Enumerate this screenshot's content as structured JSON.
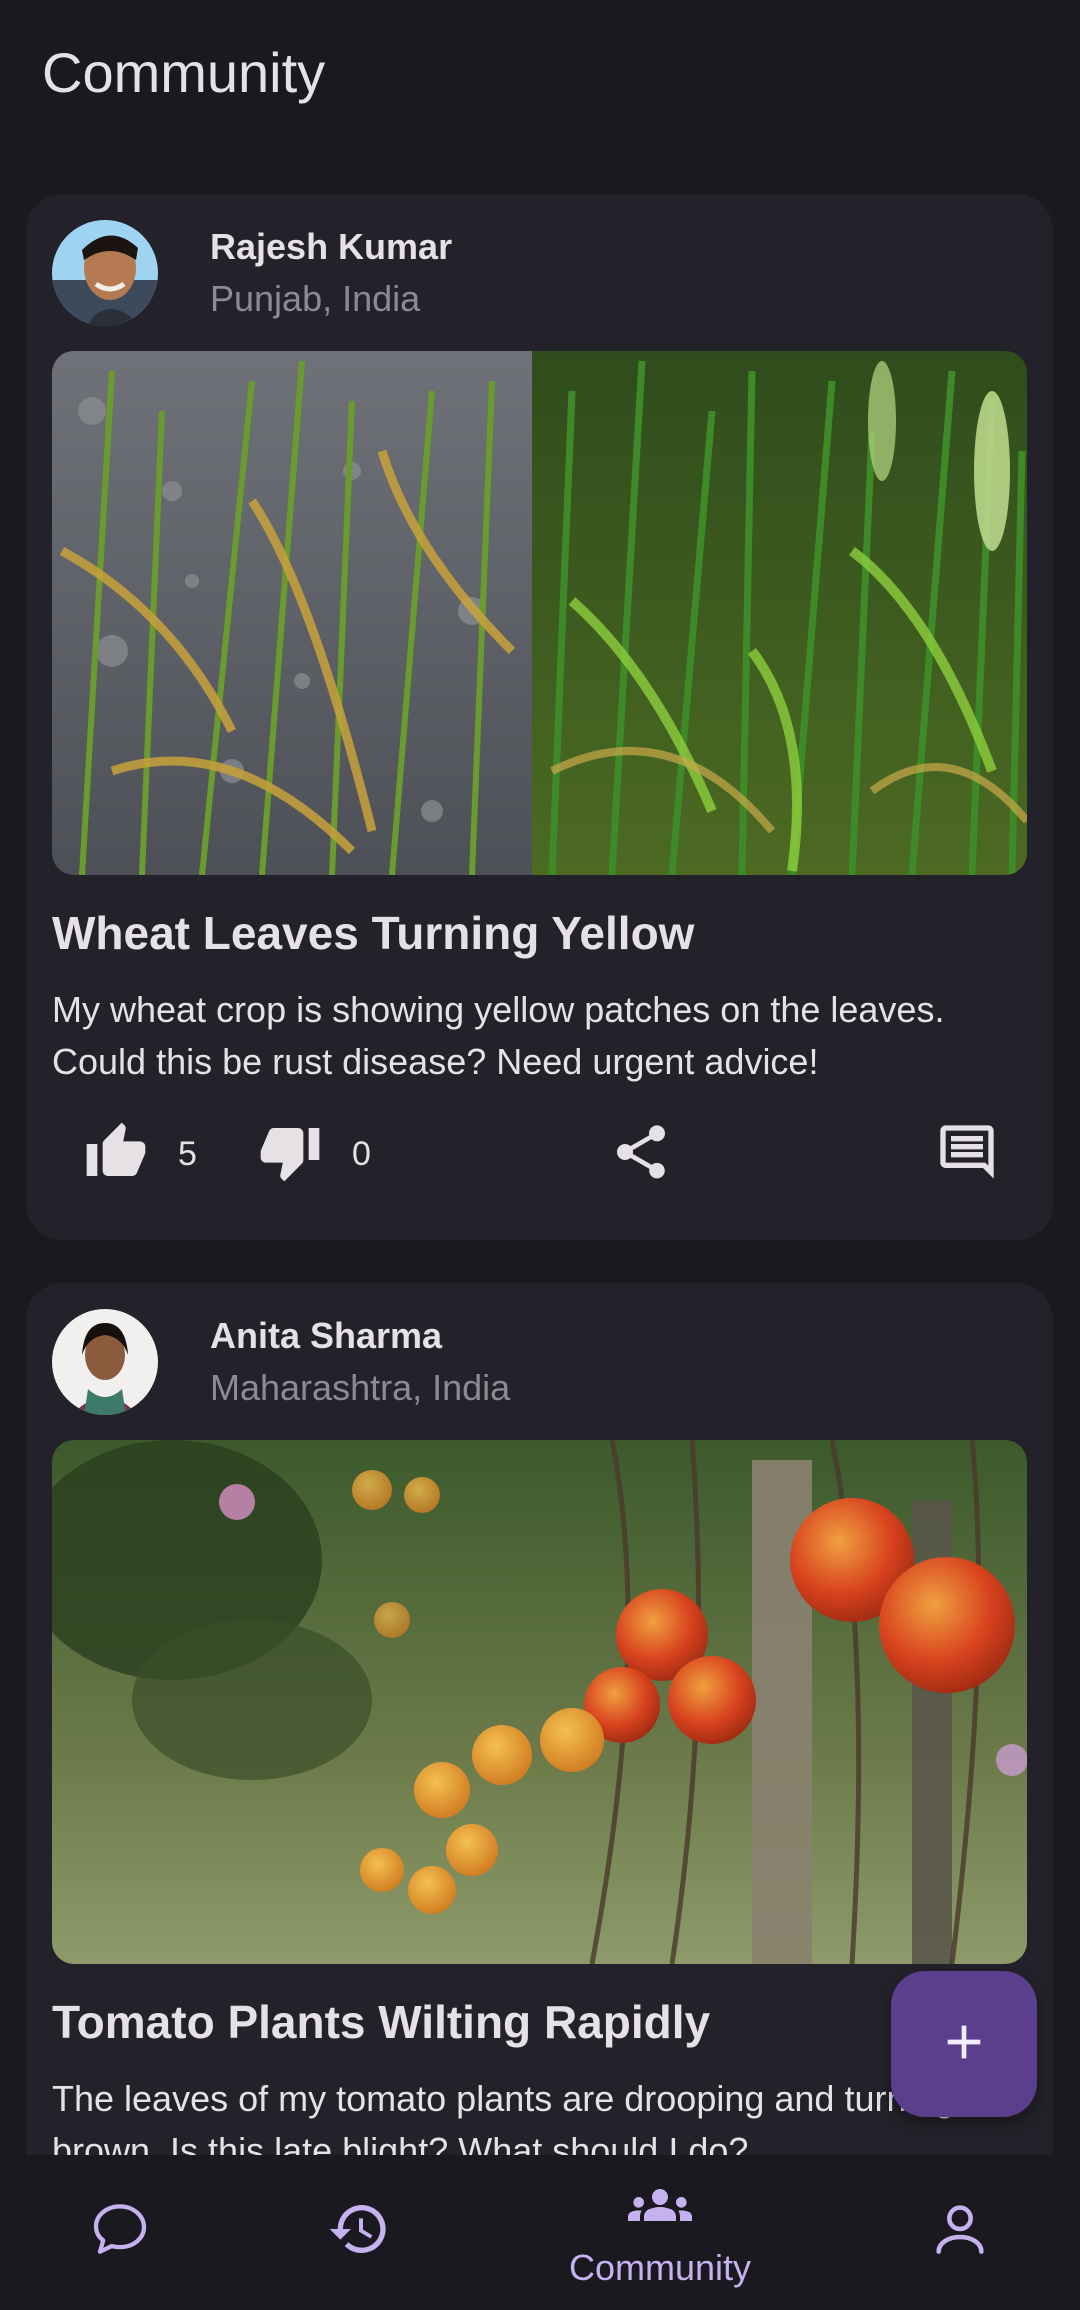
{
  "header": {
    "title": "Community"
  },
  "posts": [
    {
      "author": "Rajesh Kumar",
      "location": "Punjab, India",
      "title": "Wheat Leaves Turning Yellow",
      "body": "My wheat crop is showing yellow patches on the leaves. Could this be rust disease? Need urgent advice!",
      "likes": "5",
      "dislikes": "0"
    },
    {
      "author": "Anita Sharma",
      "location": "Maharashtra, India",
      "title": "Tomato Plants Wilting Rapidly",
      "body": "The leaves of my tomato plants are drooping and turning brown. Is this late blight? What should I do?"
    }
  ],
  "icons": {
    "like": "thumb-up-icon",
    "dislike": "thumb-down-icon",
    "share": "share-icon",
    "comment": "comment-icon",
    "fab": "plus-icon"
  },
  "nav": {
    "items": [
      {
        "icon": "chat-bubble-icon"
      },
      {
        "icon": "history-icon"
      },
      {
        "icon": "group-icon",
        "label": "Community",
        "active": true
      },
      {
        "icon": "person-icon"
      }
    ]
  },
  "colors": {
    "background": "#1a191f",
    "card": "#232129",
    "accent": "#c7b2f0",
    "fab": "#5b3f8c"
  }
}
